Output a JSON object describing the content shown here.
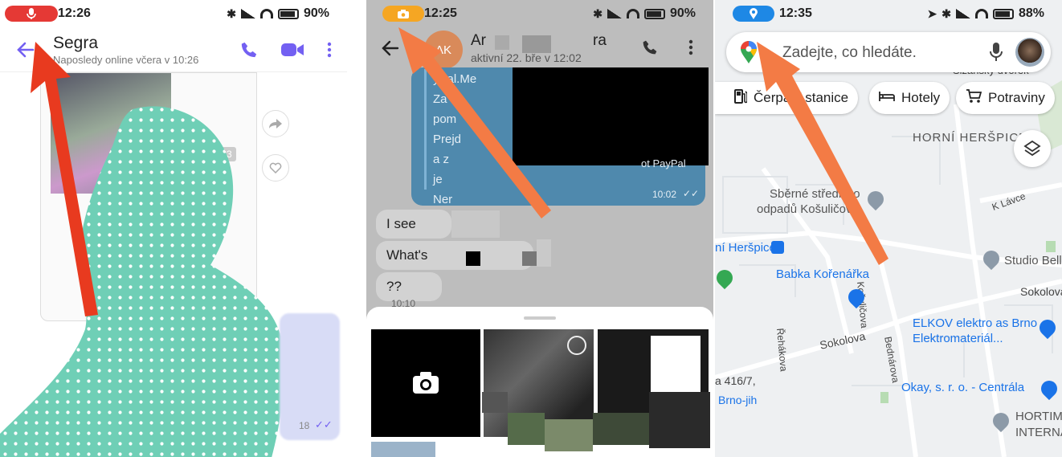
{
  "panel1": {
    "status": {
      "time": "12:26",
      "battery": "90%",
      "indicator_color": "#e53935"
    },
    "header": {
      "title": "Segra",
      "subtitle": "Naposledy online včera v 10:26"
    },
    "message": {
      "date": "27.04.23",
      "time": "18"
    },
    "accent": "#7360f2"
  },
  "panel2": {
    "status": {
      "time": "12:25",
      "battery": "90%",
      "indicator_color": "#f5a623"
    },
    "header": {
      "avatar_initials": "AK",
      "name": "Ar",
      "name_tail": "ra",
      "subtitle": "aktivní 22. bře v 12:02"
    },
    "blue_bubble": {
      "lines": [
        "yPal.Me",
        "Za",
        "pom",
        "Prejd",
        "a z",
        "je",
        "Ner"
      ],
      "time": "10:02",
      "partial": "ot PayPal"
    },
    "bubbles": [
      {
        "text": "I see",
        "time": ""
      },
      {
        "text": "What's",
        "time": ""
      },
      {
        "text": "??",
        "time": "10:10"
      }
    ]
  },
  "panel3": {
    "status": {
      "time": "12:35",
      "battery": "88%",
      "indicator_color": "#1e88e5"
    },
    "search": {
      "placeholder": "Zadejte, co hledáte."
    },
    "chips": [
      {
        "label": "Čerpací stanice",
        "icon": "fuel-icon"
      },
      {
        "label": "Hotely",
        "icon": "bed-icon"
      },
      {
        "label": "Potraviny",
        "icon": "cart-icon"
      }
    ],
    "labels": {
      "district": "HORNÍ HERŠPICE",
      "street_top": "Sizanský dvorek",
      "k_lavce": "K Lávce",
      "kosulicova": "Košuličova",
      "rehakova": "Řehákova",
      "bednarova": "Bednárova",
      "sokolova1": "Sokolova",
      "sokolova2": "Sokolova",
      "adresa": "a 416/7,",
      "brno_jih": "Brno-jih"
    },
    "pois": {
      "sberne1": "Sběrné středisko",
      "sberne2": "odpadů Košuličova",
      "station": "ní Heršpice",
      "babka": "Babka Kořenářka",
      "studio": "Studio Bell",
      "elkov1": "ELKOV elektro as Brno",
      "elkov2": "Elektromateriál...",
      "okay": "Okay, s. r. o. - Centrála",
      "hortim1": "HORTIM",
      "hortim2": "INTERNA"
    }
  }
}
